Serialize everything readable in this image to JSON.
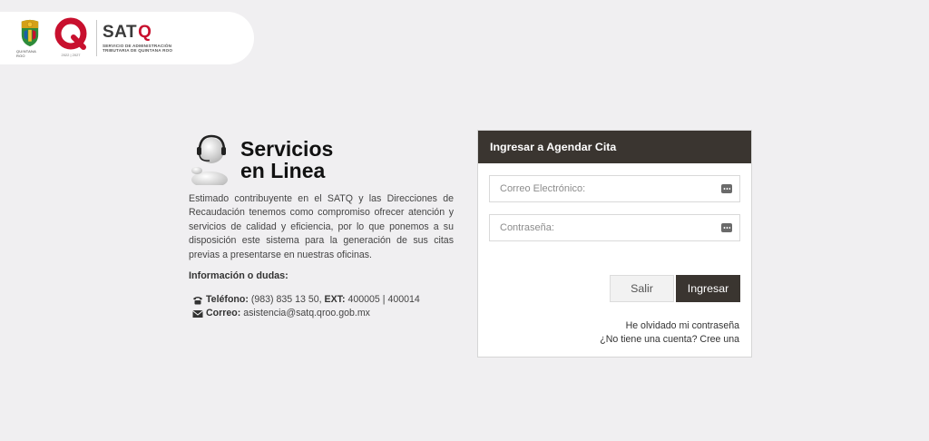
{
  "header": {
    "state_tag": "QUINTANA ROO",
    "years": "2022 | 2027",
    "brand_name": "SAT",
    "brand_q": "Q",
    "brand_line1": "SERVICIO DE ADMINISTRACIÓN",
    "brand_line2": "TRIBUTARIA DE QUINTANA ROO"
  },
  "info": {
    "title_line1": "Servicios",
    "title_line2": "en Linea",
    "description": "Estimado contribuyente en el SATQ y las Direcciones de Recaudación tenemos como compromiso ofrecer atención y servicios de calidad y eficiencia, por lo que ponemos a su disposición este sistema para la generación de sus citas previas a presentarse en nuestras oficinas.",
    "subheading": "Información o dudas:",
    "phone_label": "Teléfono:",
    "phone_number": "(983) 835 13 50,",
    "ext_label": "EXT:",
    "ext_value": "400005 | 400014",
    "email_label": "Correo:",
    "email_value": "asistencia@satq.qroo.gob.mx"
  },
  "login": {
    "header": "Ingresar a Agendar Cita",
    "email_placeholder": "Correo Electrónico:",
    "email_value": "",
    "password_placeholder": "Contraseña:",
    "password_value": "",
    "exit_button": "Salir",
    "submit_button": "Ingresar",
    "forgot_link": "He olvidado mi contraseña",
    "register_link": "¿No tiene una cuenta? Cree una"
  },
  "colors": {
    "background": "#f0eff1",
    "panel_header": "#3a3530",
    "brand_red": "#c8102e",
    "emblem_green": "#2e8b3a",
    "emblem_gold": "#d4a017"
  },
  "icons": {
    "phone": "phone-icon",
    "mail": "envelope-icon",
    "input_key": "keyboard-icon",
    "agent": "support-agent-icon"
  }
}
